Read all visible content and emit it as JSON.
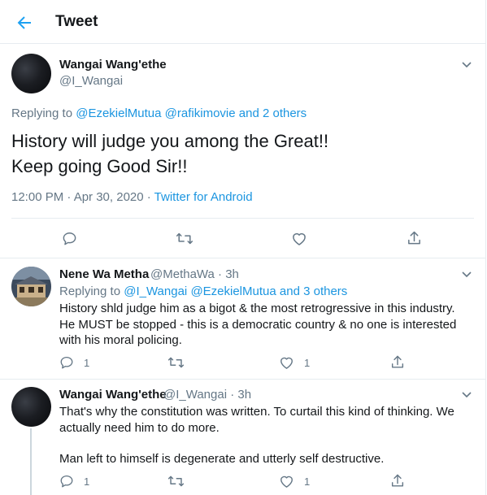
{
  "header": {
    "title": "Tweet"
  },
  "main_tweet": {
    "author_name": "Wangai Wang'ethe",
    "author_handle": "@I_Wangai",
    "replying_prefix": "Replying to ",
    "replying_mention1": "@EzekielMutua",
    "replying_mention2": "@rafikimovie",
    "replying_and": "and",
    "replying_others": "2 others",
    "text_line1": "History will judge you among the Great!!",
    "text_line2": "Keep going Good Sir!!",
    "timestamp": "12:00 PM · Apr 30, 2020",
    "meta_sep": " · ",
    "source": "Twitter for Android"
  },
  "replies": [
    {
      "author_name": "Nene Wa Metha",
      "author_handle": "@MethaWa",
      "time": "· 3h",
      "replying_prefix": "Replying to ",
      "replying_mention1": "@I_Wangai",
      "replying_mention2": "@EzekielMutua",
      "replying_and": "and",
      "replying_others": "3 others",
      "text": "History shld judge him as a bigot & the most retrogressive in this industry. He MUST be stopped - this is a democratic country & no one is interested with his moral policing.",
      "reply_count": "1",
      "like_count": "1"
    },
    {
      "author_name": "Wangai Wang'ethe",
      "author_handle": "@I_Wangai",
      "time": "· 3h",
      "text_p1": "That's why the constitution was written. To curtail this kind of thinking. We actually need him to do more.",
      "text_p2": "Man left to himself is degenerate and utterly self destructive.",
      "reply_count": "1",
      "like_count": "1"
    }
  ],
  "colors": {
    "accent": "#1da1f2",
    "link": "#1b95e0",
    "secondary_text": "#657786",
    "border": "#e6ecf0"
  },
  "icons": [
    "back-arrow-icon",
    "chevron-down-icon",
    "reply-icon",
    "retweet-icon",
    "like-icon",
    "share-icon"
  ]
}
